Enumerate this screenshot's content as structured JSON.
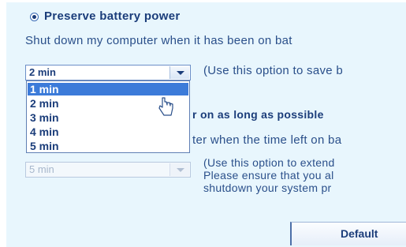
{
  "battery_option": {
    "label": "Preserve battery power",
    "description": "Shut down my computer when it has been on bat"
  },
  "idle_time": {
    "selected": "2 min",
    "hint": "(Use this option to save b",
    "options": [
      "1 min",
      "2 min",
      "3 min",
      "4 min",
      "5 min"
    ],
    "highlighted_index": 0
  },
  "power_option": {
    "label": "r on as long as possible",
    "description": "ter when the time left on ba"
  },
  "remaining_time": {
    "selected": "5 min",
    "hint_lines": [
      "(Use this option to extend",
      "Please ensure that you al",
      "shutdown your system pr"
    ]
  },
  "default_button": {
    "label": "Default"
  },
  "colors": {
    "panel_background": "#e8f6fd",
    "text_blue": "#2a4f8a",
    "highlight": "#3c7bd9"
  },
  "icons": {
    "cursor": "hand-pointer-icon",
    "dropdown_arrow": "chevron-down-icon"
  }
}
